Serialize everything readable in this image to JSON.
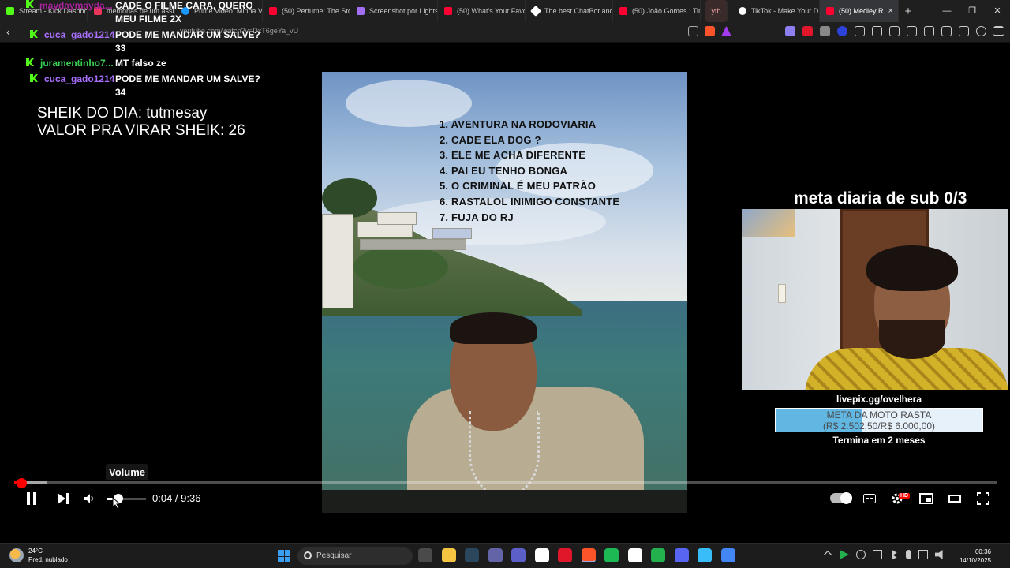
{
  "browser": {
    "tabs": [
      {
        "label": "Stream - Kick Dashbo",
        "color": "#53fc18"
      },
      {
        "label": "memórias de um assi",
        "color": "#e8365d"
      },
      {
        "label": "Prime Video: Minha V",
        "color": "#1a98ff"
      },
      {
        "label": "(50) Perfume: The Sto",
        "color": "#ff0033"
      },
      {
        "label": "Screenshot por Lights",
        "color": "#a16ef5"
      },
      {
        "label": "(50) What's Your Favo",
        "color": "#ff0033"
      },
      {
        "label": "The best ChatBot and",
        "color": "#ffffff"
      },
      {
        "label": "(50) João Gomes : Tin",
        "color": "#ff0033"
      }
    ],
    "short_tab_label": "ytb",
    "tab_tiktok": {
      "label": "TikTok - Make Your D",
      "color": "#ffffff"
    },
    "active_tab": {
      "label": "(50) Medley R",
      "close": "×",
      "color": "#ff0033"
    },
    "new_tab": "+",
    "window_controls": [
      "—",
      "❐",
      "✕"
    ],
    "url": "youtube.com/watch?v=DxT6geYa_vU",
    "back_icon": "‹"
  },
  "chat": [
    {
      "user": "maydaymayda...",
      "message": "CADE O FILME CARA, QUERO",
      "user_color": "purple"
    },
    {
      "user": "",
      "message": "MEU FILME 2X",
      "user_color": "purple"
    },
    {
      "user": "cuca_gado1214",
      "message": "PODE ME MANDAR UM SALVE?",
      "user_color": "purple"
    },
    {
      "user": "",
      "message": "33",
      "user_color": "purple"
    },
    {
      "user": "juramentinho7...",
      "message": "MT falso ze",
      "user_color": "green"
    },
    {
      "user": "cuca_gado1214",
      "message": "PODE ME MANDAR UM SALVE?",
      "user_color": "purple"
    },
    {
      "user": "",
      "message": "34",
      "user_color": "purple"
    }
  ],
  "sheik": {
    "line1": "SHEIK DO DIA: tutmesay",
    "line2": "VALOR PRA VIRAR SHEIK: 26"
  },
  "video": {
    "songs": [
      "1. AVENTURA NA RODOVIARIA",
      "2. CADE ELA DOG ?",
      "3. ELE ME ACHA DIFERENTE",
      "4. PAI EU TENHO BONGA",
      "5. O CRIMINAL É MEU PATRÃO",
      "6. RASTALOL INIMIGO CONSTANTE",
      "7. FUJA DO RJ"
    ]
  },
  "stream_overlay": {
    "meta_title": "meta diaria de sub 0/3",
    "livepix": "livepix.gg/ovelhera",
    "goal_title": "META DA MOTO RASTA",
    "goal_amount": "(R$ 2.502,50/R$ 6.000,00)",
    "goal_progress": 0.417,
    "goal_ends": "Termina em 2 meses"
  },
  "player": {
    "tooltip": "Volume",
    "time_current": "0:04",
    "time_sep": " / ",
    "time_total": "9:36",
    "played_fraction": 0.007,
    "buffered_fraction": 0.033,
    "volume_fraction": 0.3,
    "hd_badge": "HD",
    "icons": [
      "pause-icon",
      "next-icon",
      "volume-icon",
      "autoplay-toggle",
      "subtitles-icon",
      "settings-icon",
      "miniplayer-icon",
      "theater-icon",
      "fullscreen-icon"
    ]
  },
  "taskbar": {
    "temperature": "24°C",
    "weather": "Pred. nublado",
    "search_placeholder": "Pesquisar",
    "time": "00:36",
    "date": "14/10/2025",
    "app_colors": [
      "#4a4a4a",
      "#f5c542",
      "#2a475e",
      "#6264a7",
      "#5b5fc7",
      "#ffffff",
      "#e0162b",
      "#fb542b",
      "#1db954",
      "#ffffff",
      "#23b14d",
      "#5865f2",
      "#38bdf8",
      "#4285f4"
    ]
  }
}
